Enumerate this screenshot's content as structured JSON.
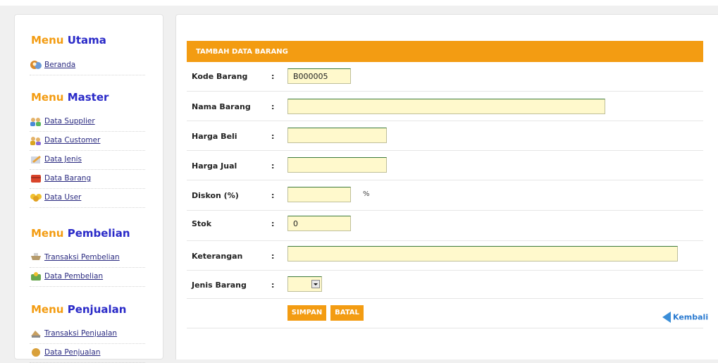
{
  "sidebar": {
    "sections": [
      {
        "title_a": "Menu",
        "title_b": "Utama",
        "items": [
          {
            "label": "Beranda",
            "icon": "home-icon"
          }
        ]
      },
      {
        "title_a": "Menu",
        "title_b": "Master",
        "items": [
          {
            "label": "Data Supplier",
            "icon": "supplier-icon"
          },
          {
            "label": "Data Customer",
            "icon": "customer-icon"
          },
          {
            "label": "Data Jenis",
            "icon": "category-icon"
          },
          {
            "label": "Data Barang",
            "icon": "box-icon"
          },
          {
            "label": "Data User",
            "icon": "users-icon"
          }
        ]
      },
      {
        "title_a": "Menu",
        "title_b": "Pembelian",
        "items": [
          {
            "label": "Transaksi Pembelian",
            "icon": "cart-icon"
          },
          {
            "label": "Data Pembelian",
            "icon": "purchase-icon"
          }
        ]
      },
      {
        "title_a": "Menu",
        "title_b": "Penjualan",
        "items": [
          {
            "label": "Transaksi Penjualan",
            "icon": "sales-icon"
          },
          {
            "label": "Data Penjualan",
            "icon": "sales-data-icon"
          }
        ]
      }
    ]
  },
  "form": {
    "header": "TAMBAH DATA BARANG",
    "colon": ":",
    "fields": {
      "kode": {
        "label": "Kode Barang",
        "value": "B000005"
      },
      "nama": {
        "label": "Nama Barang",
        "value": ""
      },
      "beli": {
        "label": "Harga Beli",
        "value": ""
      },
      "jual": {
        "label": "Harga Jual",
        "value": ""
      },
      "diskon": {
        "label": "Diskon (%)",
        "value": "",
        "suffix": "%"
      },
      "stok": {
        "label": "Stok",
        "value": "0"
      },
      "ket": {
        "label": "Keterangan",
        "value": ""
      },
      "jenis": {
        "label": "Jenis Barang",
        "value": ""
      }
    },
    "buttons": {
      "save": "SIMPAN",
      "cancel": "BATAL"
    },
    "back_label": "Kembali"
  },
  "colors": {
    "accent": "#f39c12",
    "title_blue": "#2a2ac8",
    "field_bg": "#fff9cc",
    "link": "#2a7ad0"
  }
}
